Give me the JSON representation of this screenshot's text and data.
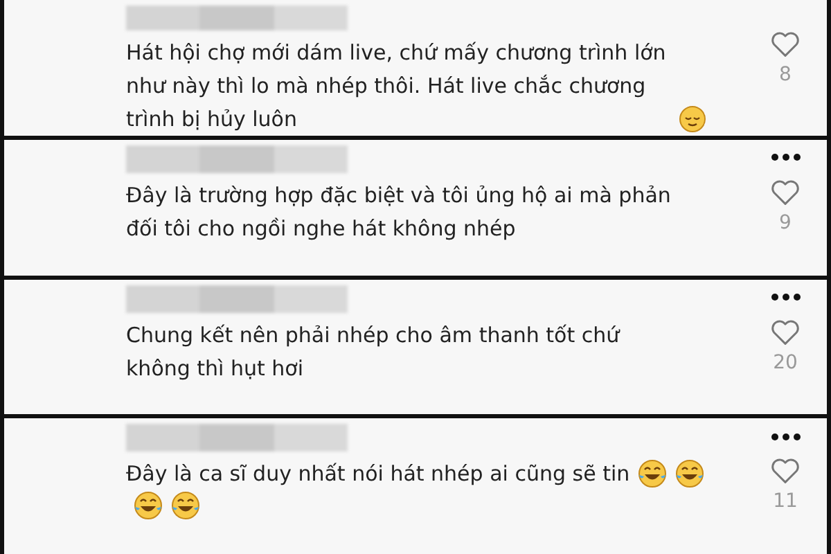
{
  "comments": [
    {
      "text": "Hát hội chợ mới dám live, chứ mấy chương trình lớn như này thì lo mà nhép thôi. Hát live chắc chương trình bị hủy luôn",
      "emojis": [
        {
          "kind": "relieved"
        }
      ],
      "likes": "8",
      "more_menu": false
    },
    {
      "text": "Đây là trường hợp đặc biệt và tôi ủng hộ ai mà phản đối tôi cho ngồi nghe hát không nhép",
      "likes": "9",
      "more_menu": true
    },
    {
      "text": "Chung kết nên phải nhép cho âm thanh tốt chứ không thì hụt hơi",
      "likes": "20",
      "more_menu": true
    },
    {
      "text": "Đây là ca sĩ duy nhất nói hát nhép ai cũng sẽ tin",
      "emojis": [
        {
          "kind": "tears_of_joy"
        },
        {
          "kind": "tears_of_joy"
        },
        {
          "kind": "tears_of_joy"
        },
        {
          "kind": "tears_of_joy"
        }
      ],
      "likes": "11",
      "more_menu": true
    }
  ]
}
